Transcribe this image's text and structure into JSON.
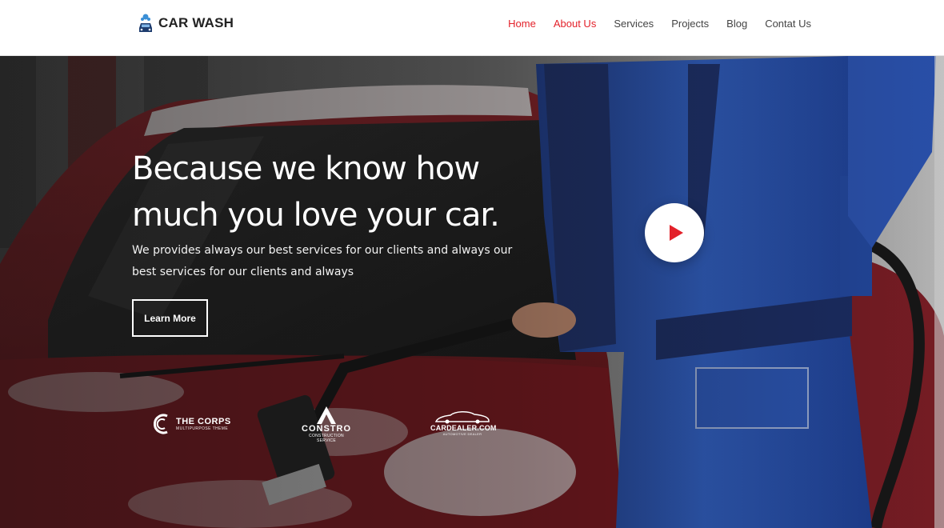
{
  "header": {
    "logo_text": "CAR WASH",
    "nav": [
      {
        "label": "Home",
        "active": true
      },
      {
        "label": "About Us",
        "active": true
      },
      {
        "label": "Services",
        "active": false
      },
      {
        "label": "Projects",
        "active": false
      },
      {
        "label": "Blog",
        "active": false
      },
      {
        "label": "Contat Us",
        "active": false
      }
    ]
  },
  "hero": {
    "title_line1": "Because we know how",
    "title_line2": "much you love your car.",
    "subtitle": "We provides always our best services for our clients and always our best services for our clients and always",
    "cta_label": "Learn More"
  },
  "partners": [
    {
      "name": "THE CORPS",
      "tagline": "MULTIPURPOSE THEME"
    },
    {
      "name": "CONSTRO",
      "tagline": "CONSTRUCTION SERVICE"
    },
    {
      "name": "CARDEALER.COM",
      "tagline": "AUTOMOTIVE DEALER"
    }
  ],
  "colors": {
    "accent": "#e3212a",
    "text": "#444444",
    "logo": "#222222"
  },
  "icons": {
    "logo": "car-wash-logo-icon",
    "play": "play-icon"
  }
}
